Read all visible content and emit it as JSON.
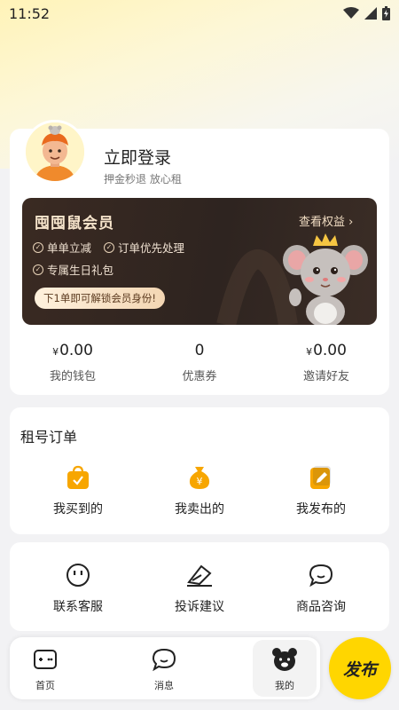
{
  "status": {
    "time": "11:52"
  },
  "profile": {
    "login_title": "立即登录",
    "login_subtitle": "押金秒退 放心租"
  },
  "vip": {
    "title": "囤囤鼠会员",
    "view_benefits": "查看权益",
    "benefits": [
      "单单立减",
      "订单优先处理",
      "专属生日礼包"
    ],
    "cta": "下1单即可解锁会员身份!"
  },
  "stats": [
    {
      "prefix": "¥",
      "value": "0.00",
      "label": "我的钱包"
    },
    {
      "prefix": "",
      "value": "0",
      "label": "优惠券"
    },
    {
      "prefix": "¥",
      "value": "0.00",
      "label": "邀请好友"
    }
  ],
  "orders": {
    "title": "租号订单",
    "items": [
      {
        "label": "我买到的",
        "icon": "shopping-bag-icon"
      },
      {
        "label": "我卖出的",
        "icon": "money-bag-icon"
      },
      {
        "label": "我发布的",
        "icon": "edit-document-icon"
      }
    ]
  },
  "services": [
    {
      "label": "联系客服",
      "icon": "customer-service-icon"
    },
    {
      "label": "投诉建议",
      "icon": "feedback-icon"
    },
    {
      "label": "商品咨询",
      "icon": "chat-bubble-icon"
    }
  ],
  "tabbar": {
    "tabs": [
      {
        "label": "首页",
        "icon": "gamepad-home-icon"
      },
      {
        "label": "消息",
        "icon": "message-icon"
      },
      {
        "label": "我的",
        "icon": "bear-profile-icon",
        "active": true
      }
    ],
    "publish_label": "发布"
  },
  "colors": {
    "accent": "#ffd600",
    "vip_bg": "#2e2420",
    "vip_text": "#f7e5cc",
    "order_icon": "#f7a600"
  }
}
